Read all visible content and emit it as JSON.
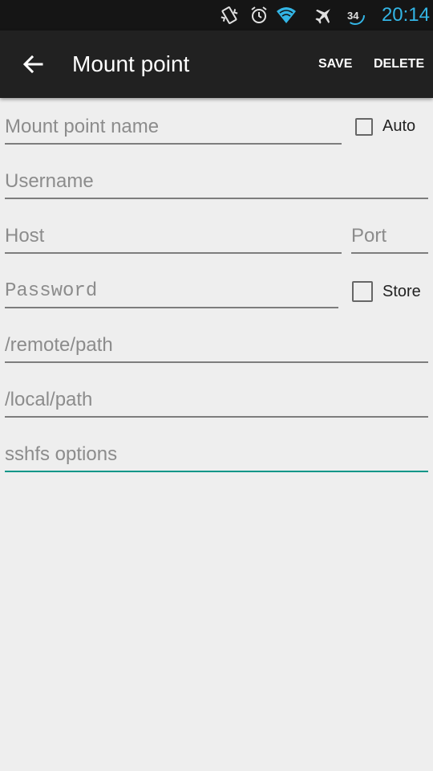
{
  "status_bar": {
    "time": "20:14",
    "battery_level": "34",
    "icons": [
      "vibrate-icon",
      "alarm-icon",
      "wifi-icon",
      "airplane-mode-icon",
      "battery-icon"
    ],
    "clock_color": "#33b5e5"
  },
  "app_bar": {
    "title": "Mount point",
    "save_label": "SAVE",
    "delete_label": "DELETE",
    "background": "#212121"
  },
  "form": {
    "mount_point_name": {
      "placeholder": "Mount point name",
      "value": ""
    },
    "auto": {
      "label": "Auto",
      "checked": false
    },
    "username": {
      "placeholder": "Username",
      "value": ""
    },
    "host": {
      "placeholder": "Host",
      "value": ""
    },
    "port": {
      "placeholder": "Port",
      "value": ""
    },
    "password": {
      "placeholder": "Password",
      "value": ""
    },
    "store": {
      "label": "Store",
      "checked": false
    },
    "remote_path": {
      "placeholder": "/remote/path",
      "value": ""
    },
    "local_path": {
      "placeholder": "/local/path",
      "value": ""
    },
    "sshfs_options": {
      "placeholder": "sshfs options",
      "value": "",
      "focused": true
    }
  },
  "colors": {
    "accent": "#009688",
    "background": "#eeeeee"
  }
}
